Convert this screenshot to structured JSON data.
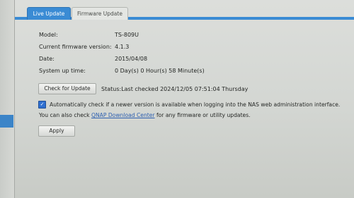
{
  "tabs": [
    {
      "label": "Live Update",
      "active": true
    },
    {
      "label": "Firmware Update",
      "active": false
    }
  ],
  "info": {
    "model_label": "Model:",
    "model_value": "TS-809U",
    "firmware_label": "Current firmware version:",
    "firmware_value": "4.1.3",
    "date_label": "Date:",
    "date_value": "2015/04/08",
    "uptime_label": "System up time:",
    "uptime_value": "0 Day(s) 0 Hour(s) 58 Minute(s)"
  },
  "check_button_label": "Check for Update",
  "status_text": "Status:Last checked 2024/12/05 07:51:04 Thursday",
  "auto_check": {
    "checked": true,
    "label": "Automatically check if a newer version is available when logging into the NAS web administration interface."
  },
  "also_check": {
    "prefix": "You can also check ",
    "link_text": "QNAP Download Center",
    "suffix": " for any firmware or utility updates."
  },
  "apply_button_label": "Apply",
  "colors": {
    "accent": "#3a8bd4",
    "link": "#2c5fb0",
    "checkbox": "#2f6fd0"
  }
}
